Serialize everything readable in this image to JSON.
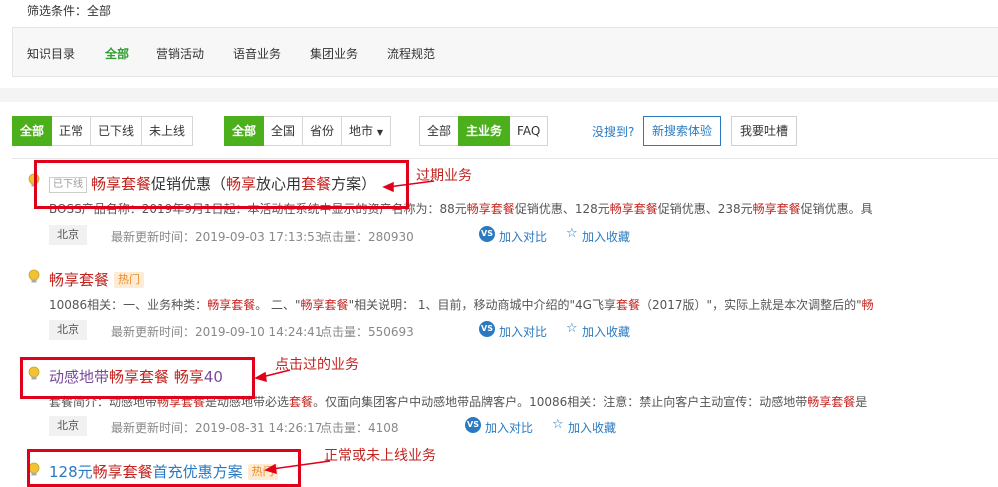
{
  "filter": {
    "label": "筛选条件：全部"
  },
  "categories": [
    "知识目录",
    "全部",
    "营销活动",
    "语音业务",
    "集团业务",
    "流程规范"
  ],
  "status_group": [
    "全部",
    "正常",
    "已下线",
    "未上线"
  ],
  "region_group": [
    "全部",
    "全国",
    "省份",
    "地市"
  ],
  "type_group": [
    "全部",
    "主业务",
    "FAQ"
  ],
  "toolbar": {
    "not_found": "没搜到?",
    "new_search": "新搜索体验",
    "feedback": "我要吐槽"
  },
  "results": [
    {
      "tag": "已下线",
      "title_parts": [
        [
          "畅享套餐",
          true
        ],
        [
          "促销优惠（",
          false
        ],
        [
          "畅享",
          true
        ],
        [
          "放心用",
          false
        ],
        [
          "套餐",
          true
        ],
        [
          "方案）",
          false
        ]
      ],
      "desc_parts": [
        [
          "BOSS产品名称：2019年9月1日起：本活动在系统中显示的资产名称为：88元",
          false
        ],
        [
          "畅享套餐",
          true
        ],
        [
          "促销优惠、128元",
          false
        ],
        [
          "畅享套餐",
          true
        ],
        [
          "促销优惠、238元",
          false
        ],
        [
          "畅享套餐",
          true
        ],
        [
          "促销优惠。具",
          false
        ]
      ],
      "city": "北京",
      "updated": "最新更新时间：2019-09-03 17:13:53",
      "clicks": "点击量：280930",
      "annotation": "过期业务"
    },
    {
      "tag": "热门",
      "title_parts": [
        [
          "畅享套餐",
          true
        ]
      ],
      "desc_parts": [
        [
          "10086相关：一、业务种类：",
          false
        ],
        [
          "畅享套餐",
          true
        ],
        [
          "。 二、\"",
          false
        ],
        [
          "畅享套餐",
          true
        ],
        [
          "\"相关说明： 1、目前，移动商城中介绍的\"4G飞享",
          false
        ],
        [
          "套餐",
          true
        ],
        [
          "（2017版）\"，实际上就是本次调整后的\"",
          false
        ],
        [
          "畅",
          true
        ]
      ],
      "city": "北京",
      "updated": "最新更新时间：2019-09-10 14:24:41",
      "clicks": "点击量：550693",
      "annotation": ""
    },
    {
      "tag": "",
      "title_parts": [
        [
          "动感地带",
          false
        ],
        [
          "畅享套餐",
          true
        ],
        [
          " ",
          false
        ],
        [
          "畅享",
          true
        ],
        [
          "40",
          false
        ]
      ],
      "desc_parts": [
        [
          "套餐简介：动感地带",
          false
        ],
        [
          "畅享套餐",
          true
        ],
        [
          "是动感地带必选",
          false
        ],
        [
          "套餐",
          true
        ],
        [
          "。仅面向集团客户中动感地带品牌客户。10086相关：注意：禁止向客户主动宣传：动感地带",
          false
        ],
        [
          "畅享套餐",
          true
        ],
        [
          "是",
          false
        ]
      ],
      "city": "北京",
      "updated": "最新更新时间：2019-08-31 14:26:17",
      "clicks": "点击量：4108",
      "annotation": "点击过的业务"
    },
    {
      "tag": "热门",
      "title_parts": [
        [
          "128元",
          false
        ],
        [
          "畅享套餐",
          true
        ],
        [
          "首充优惠方案",
          false
        ]
      ],
      "desc_parts": [],
      "city": "",
      "updated": "",
      "clicks": "",
      "annotation": "正常或未上线业务"
    }
  ],
  "actions": {
    "compare": "加入对比",
    "favorite": "加入收藏"
  },
  "colors": {
    "green": "#4caf1c",
    "blue": "#2a7ac2",
    "red": "#c2231f",
    "purple": "#7a4a9c",
    "annotation_box": "#e0001a"
  }
}
